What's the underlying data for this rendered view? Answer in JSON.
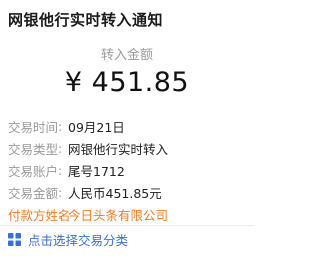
{
  "title": "网银他行实时转入通知",
  "amount_label": "转入金额",
  "amount": "¥ 451.85",
  "rows": [
    {
      "label": "交易时间",
      "sep": ":",
      "value": "09月21日"
    },
    {
      "label": "交易类型",
      "sep": ":",
      "value": "网银他行实时转入"
    },
    {
      "label": "交易账户",
      "sep": ":",
      "value": "尾号1712"
    },
    {
      "label": "交易金额",
      "sep": ":",
      "value": "人民币451.85元"
    },
    {
      "label": "付款方姓名",
      "sep": ":",
      "value": "今日头条有限公司"
    }
  ],
  "footer": {
    "icon": "grid-icon",
    "label": "点击选择交易分类"
  },
  "colors": {
    "highlight": "#f07c2a",
    "link": "#3b6fd6",
    "muted": "#9a9a9a"
  }
}
